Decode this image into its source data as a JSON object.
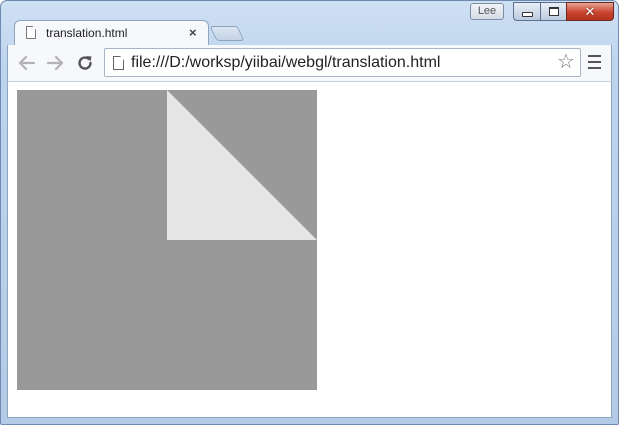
{
  "window": {
    "user_badge": "Lee",
    "close_glyph": "✕"
  },
  "tab": {
    "title": "translation.html",
    "close_glyph": "×"
  },
  "toolbar": {
    "url": "file:///D:/worksp/yiibai/webgl/translation.html",
    "star_glyph": "☆"
  },
  "canvas": {
    "background_color": "#999999",
    "triangle_color": "#e6e6e6"
  },
  "icons": {
    "back": "back-arrow-icon",
    "forward": "forward-arrow-icon",
    "reload": "reload-icon",
    "page": "page-icon",
    "star": "star-icon",
    "menu": "menu-icon"
  }
}
